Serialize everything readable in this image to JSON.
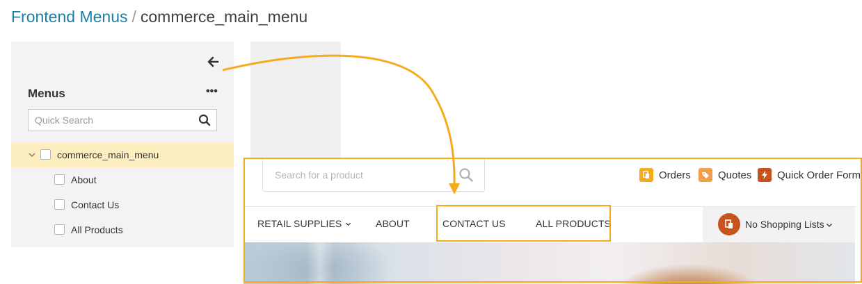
{
  "breadcrumb": {
    "parent": "Frontend Menus",
    "separator": "/",
    "current": "commerce_main_menu"
  },
  "sidebar": {
    "title": "Menus",
    "more_label": "•••",
    "search": {
      "placeholder": "Quick Search",
      "value": ""
    },
    "tree": {
      "root": {
        "label": "commerce_main_menu",
        "expanded": true,
        "selected": true
      },
      "children": [
        {
          "label": "About"
        },
        {
          "label": "Contact Us"
        },
        {
          "label": "All Products"
        }
      ]
    }
  },
  "storefront": {
    "search": {
      "placeholder": "Search for a product",
      "value": ""
    },
    "quick_links": [
      {
        "label": "Orders",
        "icon": "orders-icon",
        "color": "#f5ab1c"
      },
      {
        "label": "Quotes",
        "icon": "tag-icon",
        "color": "#f0a04b"
      },
      {
        "label": "Quick Order Form",
        "icon": "lightning-icon",
        "color": "#c8531d"
      }
    ],
    "nav": [
      {
        "label": "RETAIL SUPPLIES",
        "has_dropdown": true
      },
      {
        "label": "ABOUT"
      },
      {
        "label": "CONTACT US"
      },
      {
        "label": "ALL PRODUCTS"
      }
    ],
    "shopping_lists": {
      "label": "No Shopping Lists",
      "icon": "shopping-list-icon",
      "color": "#c8531d"
    }
  },
  "colors": {
    "link": "#1f7ea8",
    "highlight": "#f5ab1c",
    "selected_row": "#fdefc0",
    "panel_bg": "#f3f3f3"
  }
}
